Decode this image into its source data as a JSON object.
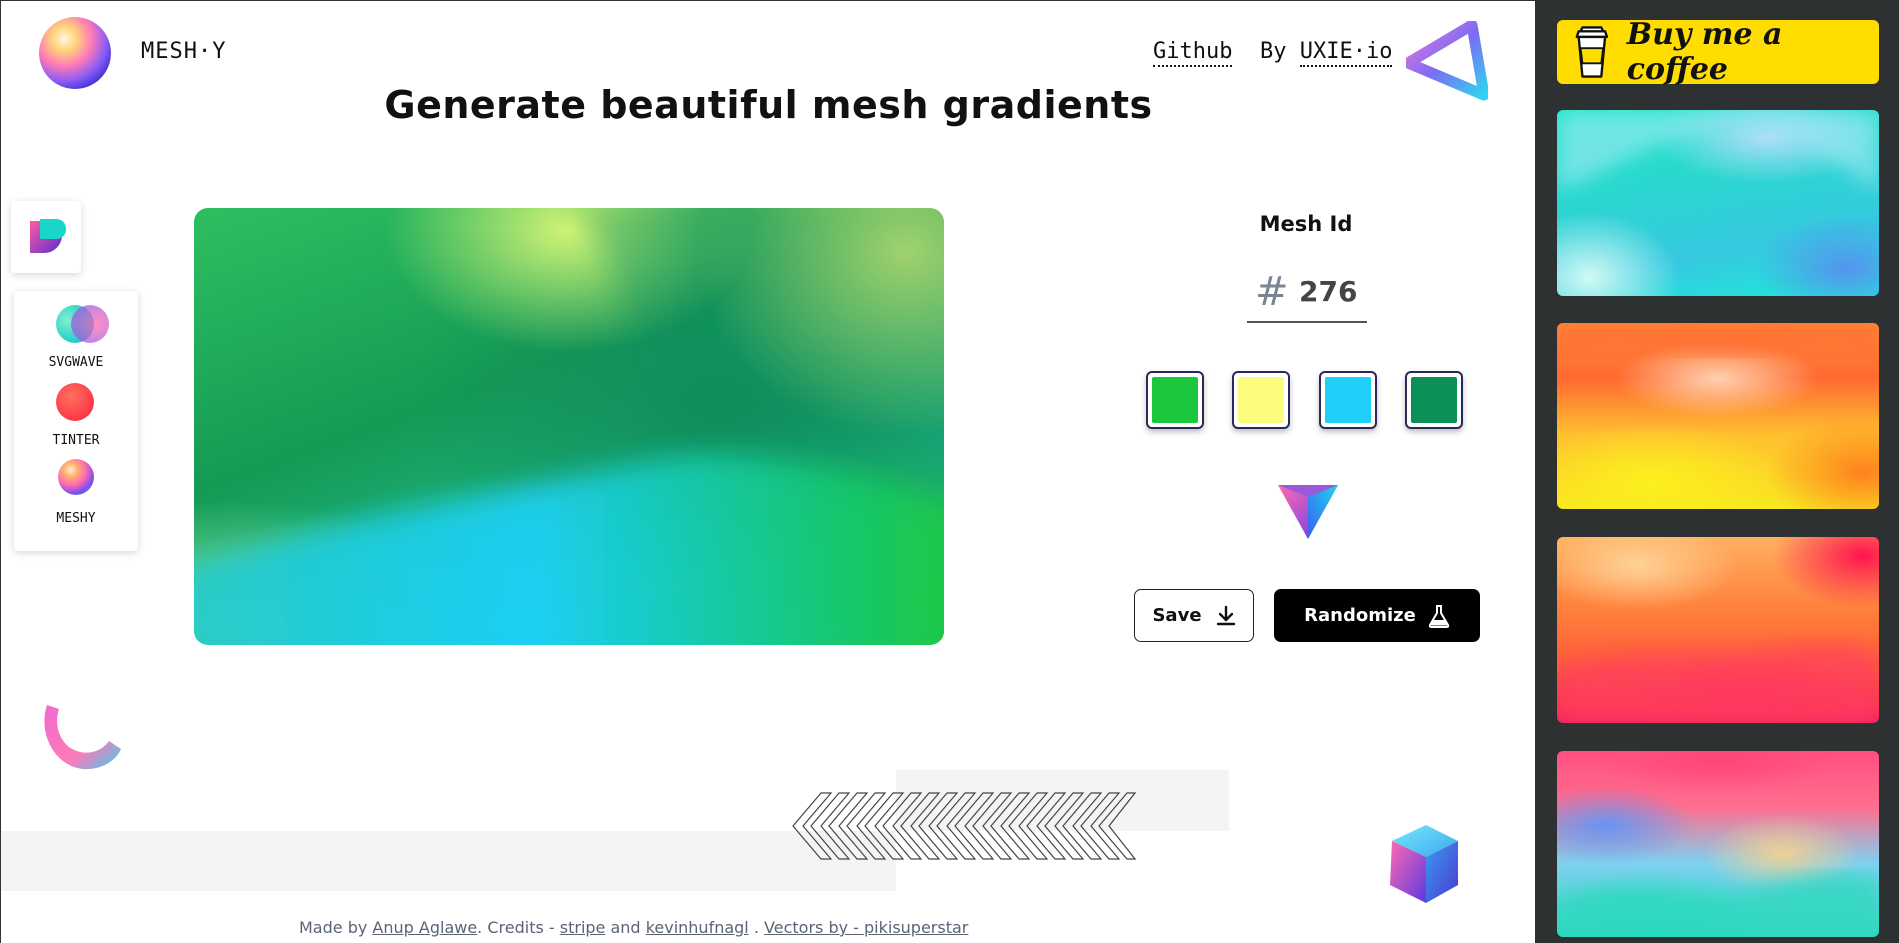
{
  "header": {
    "logo_text": "MESH·Y",
    "github_label": "Github",
    "by_label": "By",
    "uxie_label": "UXIE·io",
    "heading": "Generate beautiful mesh gradients"
  },
  "apps": {
    "items": [
      {
        "label": "SVGWAVE"
      },
      {
        "label": "TINTER"
      },
      {
        "label": "MESHY"
      }
    ]
  },
  "mesh": {
    "id_label": "Mesh Id",
    "hash_symbol": "#",
    "id_value": "276",
    "colors": [
      "#1bc83d",
      "#fcfc7c",
      "#1ed0f8",
      "#0b9158"
    ]
  },
  "actions": {
    "save_label": "Save",
    "randomize_label": "Randomize"
  },
  "footer": {
    "made_by_prefix": "Made by",
    "author": "Anup Aglawe",
    "credits_prefix": ". Credits -",
    "credit1": "stripe",
    "and_text": "and",
    "credit2": "kevinhufnagl",
    "sep": ".",
    "vectors": "Vectors by - pikisuperstar"
  },
  "sidebar": {
    "bmc_label": "Buy me a coffee",
    "thumbnails": [
      "cyan-mesh",
      "orange-yellow-mesh",
      "orange-red-mesh",
      "pink-blue-mesh"
    ]
  },
  "icons": [
    "download-icon",
    "flask-icon",
    "coffee-cup-icon",
    "prism-icon",
    "cube-icon",
    "ring-icon",
    "triangle-icon",
    "chevrons-icon"
  ]
}
